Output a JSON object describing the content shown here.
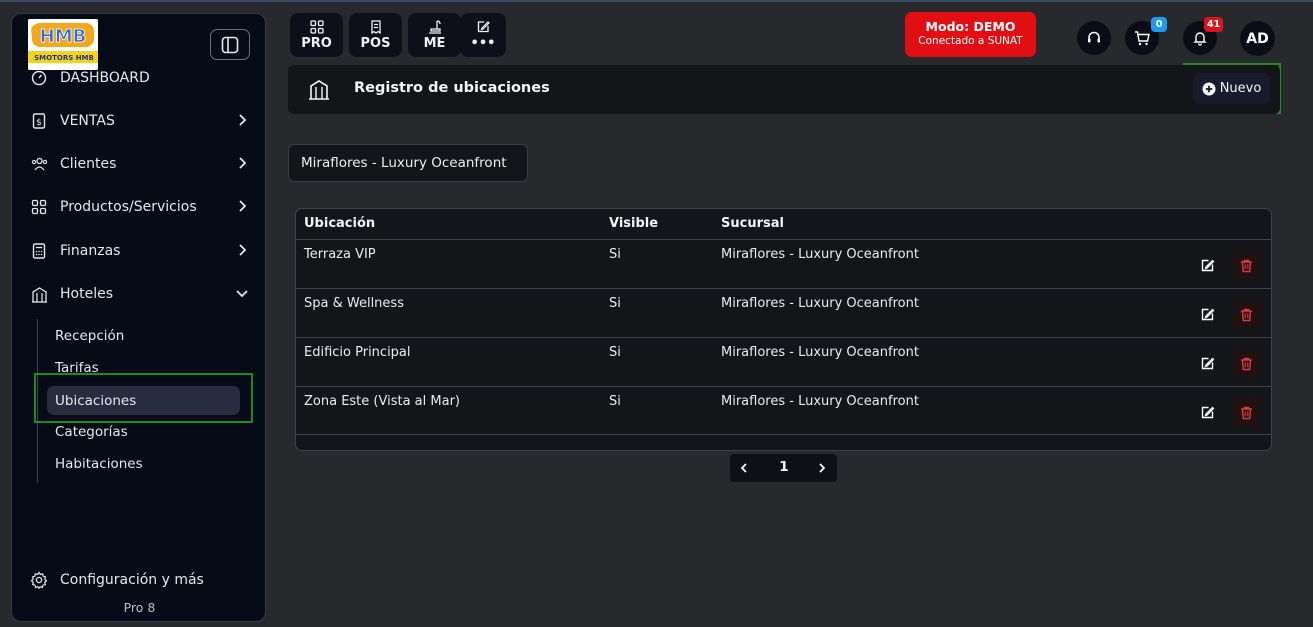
{
  "colors": {
    "brand_red": "#e10f13",
    "highlight_green": "#1f8a1f",
    "delete_red": "#e03b3b",
    "badge_blue": "#1e9bf0"
  },
  "sidebar": {
    "logo_text": "HMB",
    "logo_subtext": "SMOTORS HMB",
    "items": [
      {
        "label": "DASHBOARD",
        "icon": "gauge-icon",
        "has_chevron": false
      },
      {
        "label": "VENTAS",
        "icon": "receipt-dollar-icon",
        "has_chevron": true
      },
      {
        "label": "Clientes",
        "icon": "users-icon",
        "has_chevron": true
      },
      {
        "label": "Productos/Servicios",
        "icon": "grid-icon",
        "has_chevron": true
      },
      {
        "label": "Finanzas",
        "icon": "calculator-icon",
        "has_chevron": true
      },
      {
        "label": "Hoteles",
        "icon": "building-icon",
        "has_chevron": true,
        "expanded": true
      }
    ],
    "subitems": [
      "Recepción",
      "Tarifas",
      "Ubicaciones",
      "Categorías",
      "Habitaciones"
    ],
    "active_subitem": "Ubicaciones",
    "settings_label": "Configuración y más",
    "version_label": "Pro 8"
  },
  "topbar": {
    "buttons": [
      {
        "label": "PRO",
        "icon": "grid-icon"
      },
      {
        "label": "POS",
        "icon": "receipt-icon"
      },
      {
        "label": "ME",
        "icon": "stamp-icon"
      },
      {
        "label": "•••",
        "icon": "edit-icon"
      }
    ],
    "mode_title": "Modo: DEMO",
    "mode_subtitle": "Conectado a SUNAT",
    "cart_count": "0",
    "notifications_count": "41",
    "avatar_initials": "AD"
  },
  "page": {
    "title": "Registro de ubicaciones",
    "new_button": "Nuevo",
    "branch_selected": "Miraflores - Luxury Oceanfront"
  },
  "table": {
    "headers": [
      "Ubicación",
      "Visible",
      "Sucursal"
    ],
    "rows": [
      [
        "Terraza VIP",
        "Si",
        "Miraflores - Luxury Oceanfront"
      ],
      [
        "Spa & Wellness",
        "Si",
        "Miraflores - Luxury Oceanfront"
      ],
      [
        "Edificio Principal",
        "Si",
        "Miraflores - Luxury Oceanfront"
      ],
      [
        "Zona Este (Vista al Mar)",
        "Si",
        "Miraflores - Luxury Oceanfront"
      ]
    ]
  },
  "pagination": {
    "current_page": "1"
  }
}
